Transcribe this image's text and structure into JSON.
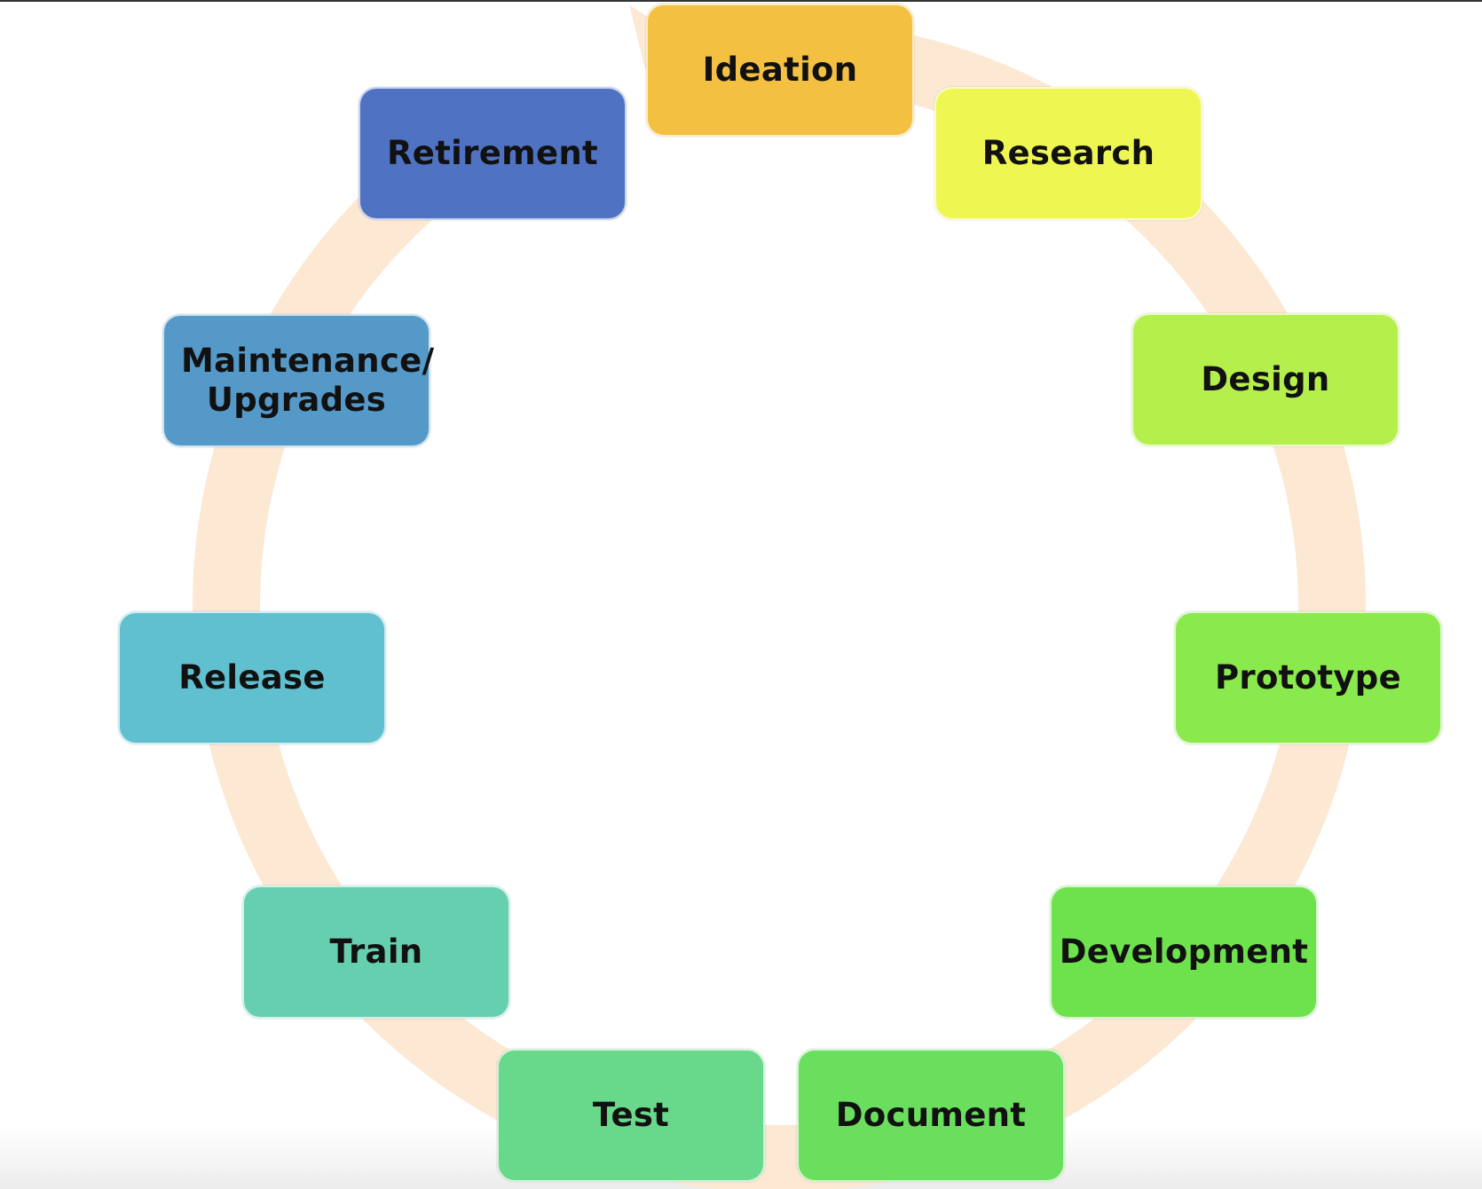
{
  "diagram": {
    "type": "cycle",
    "ring_color": "#fce8d3",
    "stages": [
      {
        "id": "ideation",
        "label": "Ideation",
        "color": "#f4c042"
      },
      {
        "id": "research",
        "label": "Research",
        "color": "#eef752"
      },
      {
        "id": "design",
        "label": "Design",
        "color": "#b5ef4c"
      },
      {
        "id": "prototype",
        "label": "Prototype",
        "color": "#8ae94d"
      },
      {
        "id": "development",
        "label": "Development",
        "color": "#6ee24c"
      },
      {
        "id": "document",
        "label": "Document",
        "color": "#6adf5e"
      },
      {
        "id": "test",
        "label": "Test",
        "color": "#68d88a"
      },
      {
        "id": "train",
        "label": "Train",
        "color": "#66cfaf"
      },
      {
        "id": "release",
        "label": "Release",
        "color": "#60c0cf"
      },
      {
        "id": "maintenance",
        "label": "Maintenance/ Upgrades",
        "color": "#5599c9"
      },
      {
        "id": "retirement",
        "label": "Retirement",
        "color": "#4f73c2"
      }
    ],
    "edges": [
      [
        "ideation",
        "research"
      ],
      [
        "research",
        "design"
      ],
      [
        "design",
        "prototype"
      ],
      [
        "prototype",
        "development"
      ],
      [
        "development",
        "document"
      ],
      [
        "document",
        "test"
      ],
      [
        "test",
        "train"
      ],
      [
        "train",
        "release"
      ],
      [
        "release",
        "maintenance"
      ],
      [
        "maintenance",
        "retirement"
      ],
      [
        "retirement",
        "ideation"
      ]
    ]
  }
}
